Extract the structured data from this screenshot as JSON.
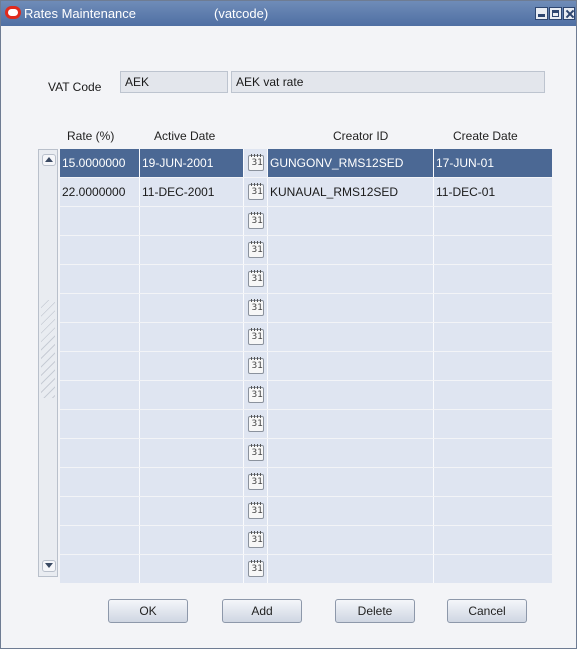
{
  "window": {
    "title": "Rates Maintenance",
    "subtitle": "(vatcode)"
  },
  "vat": {
    "label": "VAT Code",
    "code": "AEK",
    "description": "AEK vat rate"
  },
  "columns": [
    "Rate (%)",
    "Active Date",
    "Creator ID",
    "Create Date"
  ],
  "calendar_icon_text": "31",
  "rows": [
    {
      "rate": "15.0000000",
      "active_date": "19-JUN-2001",
      "creator_id": "GUNGONV_RMS12SED",
      "create_date": "17-JUN-01",
      "selected": true
    },
    {
      "rate": "22.0000000",
      "active_date": "11-DEC-2001",
      "creator_id": "KUNAUAL_RMS12SED",
      "create_date": "11-DEC-01",
      "selected": false
    },
    {
      "rate": "",
      "active_date": "",
      "creator_id": "",
      "create_date": ""
    },
    {
      "rate": "",
      "active_date": "",
      "creator_id": "",
      "create_date": ""
    },
    {
      "rate": "",
      "active_date": "",
      "creator_id": "",
      "create_date": ""
    },
    {
      "rate": "",
      "active_date": "",
      "creator_id": "",
      "create_date": ""
    },
    {
      "rate": "",
      "active_date": "",
      "creator_id": "",
      "create_date": ""
    },
    {
      "rate": "",
      "active_date": "",
      "creator_id": "",
      "create_date": ""
    },
    {
      "rate": "",
      "active_date": "",
      "creator_id": "",
      "create_date": ""
    },
    {
      "rate": "",
      "active_date": "",
      "creator_id": "",
      "create_date": ""
    },
    {
      "rate": "",
      "active_date": "",
      "creator_id": "",
      "create_date": ""
    },
    {
      "rate": "",
      "active_date": "",
      "creator_id": "",
      "create_date": ""
    },
    {
      "rate": "",
      "active_date": "",
      "creator_id": "",
      "create_date": ""
    },
    {
      "rate": "",
      "active_date": "",
      "creator_id": "",
      "create_date": ""
    },
    {
      "rate": "",
      "active_date": "",
      "creator_id": "",
      "create_date": ""
    }
  ],
  "buttons": {
    "ok": "OK",
    "add": "Add",
    "delete": "Delete",
    "cancel": "Cancel"
  },
  "colors": {
    "title_bar": "#5677ab",
    "selected_row": "#4b6894",
    "row": "#dfe5f1",
    "logo": "#e02a1d"
  }
}
